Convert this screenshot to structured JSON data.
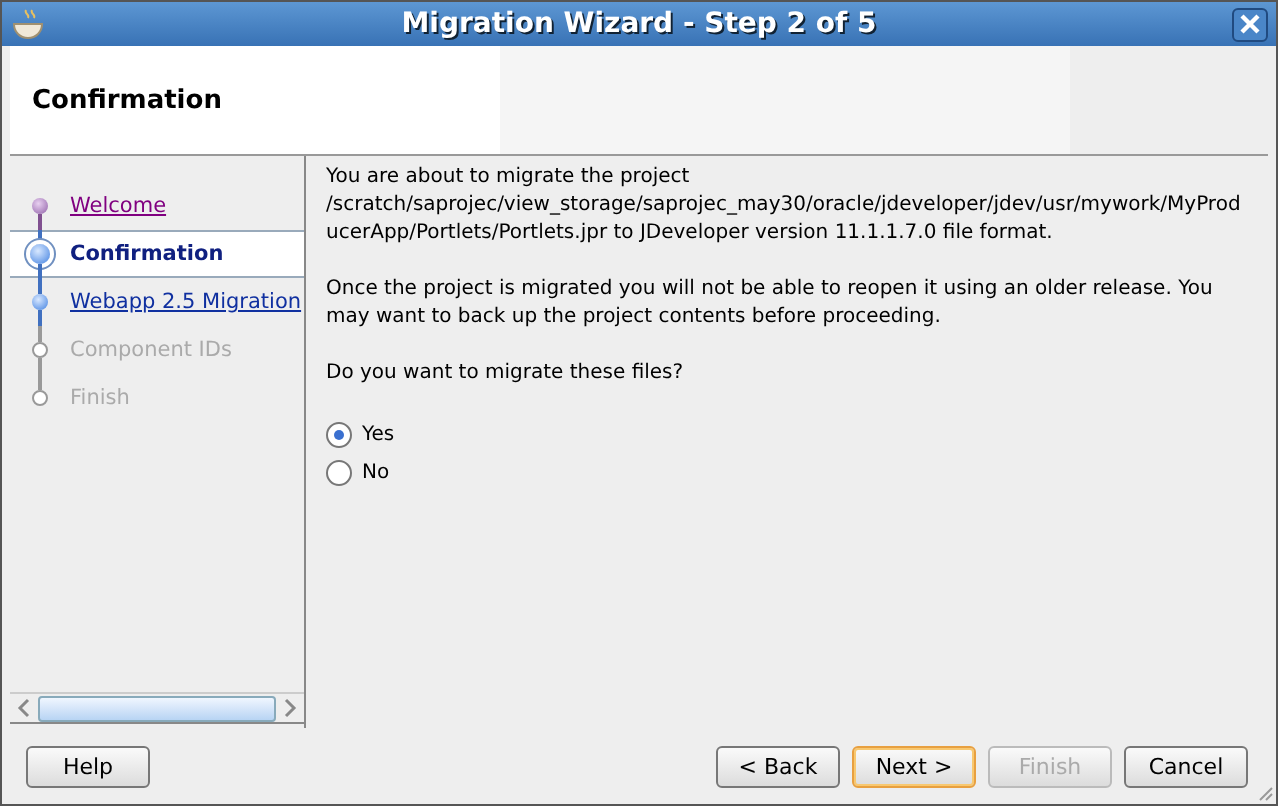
{
  "window": {
    "title": "Migration Wizard - Step 2 of 5"
  },
  "header": {
    "title": "Confirmation"
  },
  "steps": [
    {
      "label": "Welcome",
      "kind": "visited",
      "selected": false
    },
    {
      "label": "Confirmation",
      "kind": "link",
      "selected": true
    },
    {
      "label": "Webapp 2.5 Migration",
      "kind": "link",
      "selected": false
    },
    {
      "label": "Component IDs",
      "kind": "disabled",
      "selected": false
    },
    {
      "label": "Finish",
      "kind": "disabled",
      "selected": false
    }
  ],
  "content": {
    "paragraphs": [
      "You are about to migrate the project /scratch/saprojec/view_storage/saprojec_may30/oracle/jdeveloper/jdev/usr/mywork/MyProducerApp/Portlets/Portlets.jpr to JDeveloper version 11.1.1.7.0 file format.",
      "Once the project is migrated you will not be able to reopen it using an older release. You may want to back up the project contents before proceeding.",
      "Do you want to migrate these files?"
    ],
    "options": [
      {
        "label": "Yes",
        "selected": true
      },
      {
        "label": "No",
        "selected": false
      }
    ]
  },
  "left_buttons": [
    {
      "label": "Help",
      "disabled": false,
      "default": false
    }
  ],
  "right_buttons": [
    {
      "label": "< Back",
      "disabled": false,
      "default": false
    },
    {
      "label": "Next >",
      "disabled": false,
      "default": true
    },
    {
      "label": "Finish",
      "disabled": true,
      "default": false
    },
    {
      "label": "Cancel",
      "disabled": false,
      "default": false
    }
  ]
}
